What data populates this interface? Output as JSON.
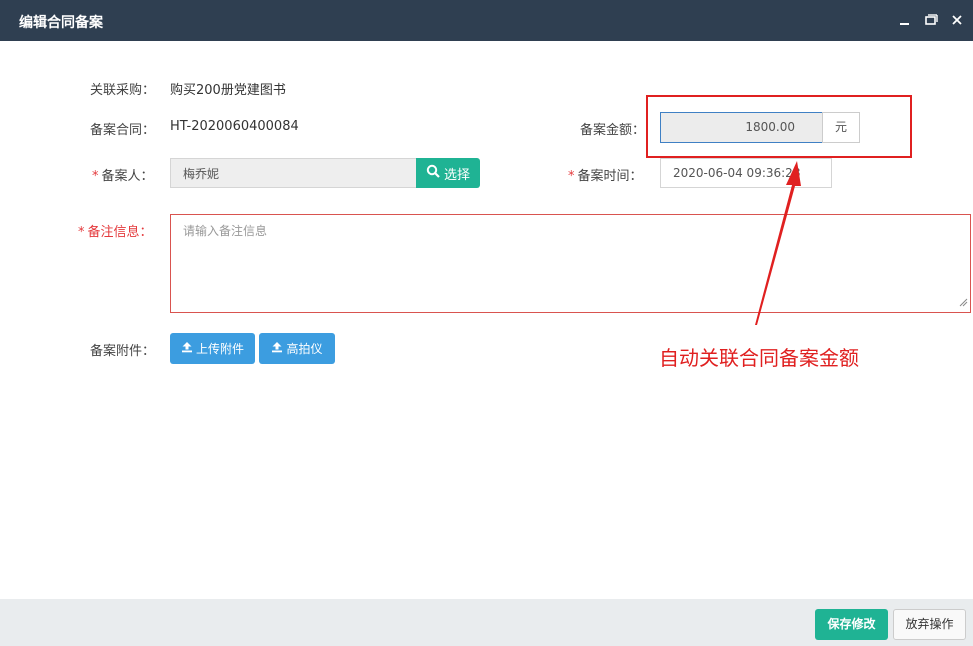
{
  "window": {
    "title": "编辑合同备案"
  },
  "form": {
    "related_purchase": {
      "label": "关联采购：",
      "value": "购买200册党建图书"
    },
    "contract": {
      "label": "备案合同：",
      "value": "HT-2020060400084"
    },
    "amount": {
      "label": "备案金额：",
      "value": "1800.00",
      "unit": "元"
    },
    "person": {
      "required_mark": "*",
      "label": "备案人：",
      "value": "梅乔妮",
      "select_label": "选择"
    },
    "time": {
      "required_mark": "*",
      "label": "备案时间：",
      "value": "2020-06-04 09:36:28"
    },
    "remark": {
      "required_mark": "*",
      "label": "备注信息：",
      "placeholder": "请输入备注信息"
    },
    "attachment": {
      "label": "备案附件：",
      "upload_label": "上传附件",
      "scanner_label": "高拍仪"
    }
  },
  "annotation": {
    "text": "自动关联合同备案金额",
    "color": "#e02020"
  },
  "footer": {
    "save_label": "保存修改",
    "cancel_label": "放弃操作"
  },
  "colors": {
    "titlebar": "#2f3f51",
    "primary_green": "#1fb394",
    "primary_blue": "#3c9de0",
    "required_red": "#e4393c"
  }
}
